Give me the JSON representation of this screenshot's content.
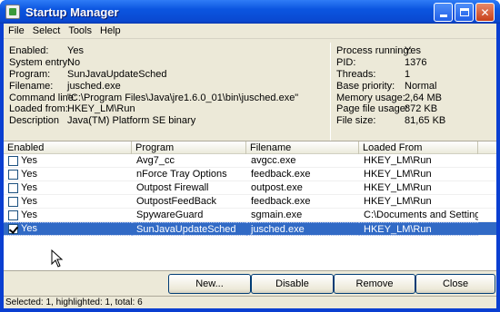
{
  "window": {
    "title": "Startup Manager"
  },
  "menu": [
    "File",
    "Select",
    "Tools",
    "Help"
  ],
  "details_left": [
    {
      "label": "Enabled:",
      "value": "Yes"
    },
    {
      "label": "System entry:",
      "value": "No"
    },
    {
      "label": "Program:",
      "value": "SunJavaUpdateSched"
    },
    {
      "label": "Filename:",
      "value": "jusched.exe"
    },
    {
      "label": "Command line:",
      "value": "\"C:\\Program Files\\Java\\jre1.6.0_01\\bin\\jusched.exe\""
    },
    {
      "label": "Loaded from:",
      "value": "HKEY_LM\\Run"
    },
    {
      "label": "Description",
      "value": "Java(TM) Platform SE binary"
    }
  ],
  "details_right": [
    {
      "label": "Process running:",
      "value": "Yes"
    },
    {
      "label": "PID:",
      "value": "1376"
    },
    {
      "label": "Threads:",
      "value": "1"
    },
    {
      "label": "Base priority:",
      "value": "Normal"
    },
    {
      "label": "Memory usage:",
      "value": "2,64 MB"
    },
    {
      "label": "Page file usage:",
      "value": "872 KB"
    },
    {
      "label": "File size:",
      "value": "81,65 KB"
    }
  ],
  "table": {
    "columns": [
      "Enabled",
      "Program",
      "Filename",
      "Loaded From"
    ],
    "rows": [
      {
        "enabled": "Yes",
        "checked": false,
        "program": "Avg7_cc",
        "filename": "avgcc.exe",
        "loaded_from": "HKEY_LM\\Run"
      },
      {
        "enabled": "Yes",
        "checked": false,
        "program": "nForce Tray Options",
        "filename": "feedback.exe",
        "loaded_from": "HKEY_LM\\Run"
      },
      {
        "enabled": "Yes",
        "checked": false,
        "program": "Outpost Firewall",
        "filename": "outpost.exe",
        "loaded_from": "HKEY_LM\\Run"
      },
      {
        "enabled": "Yes",
        "checked": false,
        "program": "OutpostFeedBack",
        "filename": "feedback.exe",
        "loaded_from": "HKEY_LM\\Run"
      },
      {
        "enabled": "Yes",
        "checked": false,
        "program": "SpywareGuard",
        "filename": "sgmain.exe",
        "loaded_from": "C:\\Documents and Setting..."
      },
      {
        "enabled": "Yes",
        "checked": true,
        "selected": true,
        "program": "SunJavaUpdateSched",
        "filename": "jusched.exe",
        "loaded_from": "HKEY_LM\\Run"
      }
    ]
  },
  "buttons": {
    "new": "New...",
    "disable": "Disable",
    "remove": "Remove",
    "close": "Close"
  },
  "status": "Selected: 1, highlighted: 1, total: 6",
  "colors": {
    "titlebar": "#0b55e0",
    "selection": "#316ac5",
    "face": "#ece9d8"
  }
}
